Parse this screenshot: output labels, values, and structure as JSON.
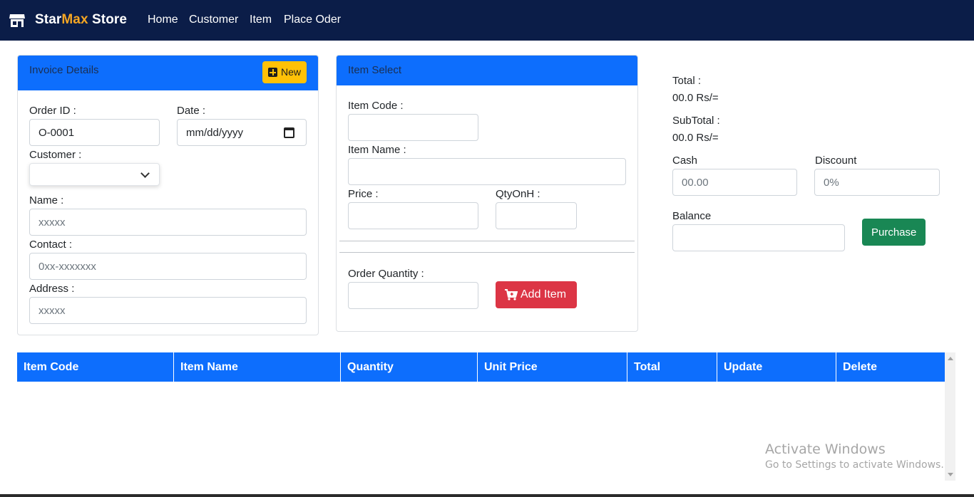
{
  "navbar": {
    "brand_prefix": "Star",
    "brand_highlight": "Max",
    "brand_suffix": " Store",
    "brand_icon": "store-icon",
    "links": [
      "Home",
      "Customer",
      "Item",
      "Place Oder"
    ]
  },
  "invoice": {
    "title": "Invoice Details",
    "new_button": "New",
    "order_id_label": "Order ID :",
    "order_id_value": "O-0001",
    "date_label": "Date :",
    "date_placeholder": "mm/dd/yyyy",
    "customer_label": "Customer :",
    "customer_selected": "",
    "name_label": "Name :",
    "name_placeholder": "xxxxx",
    "contact_label": "Contact :",
    "contact_placeholder": "0xx-xxxxxxx",
    "address_label": "Address :",
    "address_placeholder": "xxxxx"
  },
  "item_select": {
    "title": "Item Select",
    "item_code_label": "Item Code :",
    "item_name_label": "Item Name :",
    "price_label": "Price :",
    "qty_on_hand_label": "QtyOnH :",
    "order_qty_label": "Order Quantity :",
    "add_button": "Add Item"
  },
  "summary": {
    "total_label": "Total :",
    "total_value": "00.0 Rs/=",
    "subtotal_label": "SubTotal :",
    "subtotal_value": "00.0 Rs/=",
    "cash_label": "Cash",
    "cash_placeholder": "00.00",
    "discount_label": "Discount",
    "discount_placeholder": "0%",
    "balance_label": "Balance",
    "purchase_button": "Purchase"
  },
  "table": {
    "columns": [
      "Item Code",
      "Item Name",
      "Quantity",
      "Unit Price",
      "Total",
      "Update",
      "Delete"
    ],
    "rows": []
  },
  "watermark": {
    "line1": "Activate Windows",
    "line2": "Go to Settings to activate Windows."
  },
  "colors": {
    "navbar": "#0b1d48",
    "primary": "#0d6efd",
    "warning": "#ffc107",
    "danger": "#dc3545",
    "success": "#198754"
  }
}
